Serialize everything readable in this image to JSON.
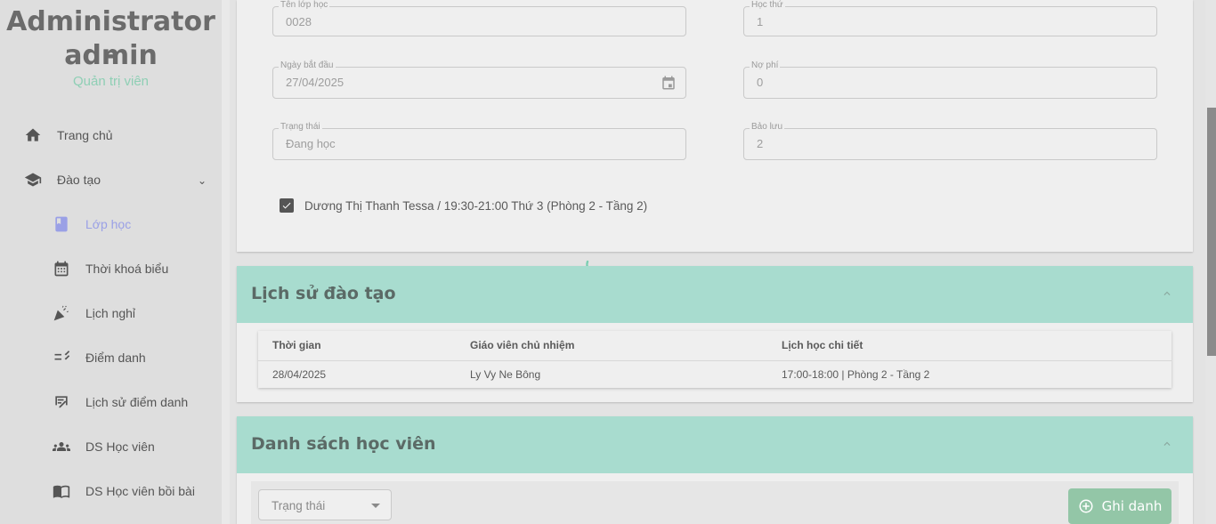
{
  "sidebar": {
    "user_name_line1": "Administrator -",
    "user_name_line2": "admin",
    "user_role": "Quản trị viên",
    "items": [
      {
        "label": "Trang chủ",
        "icon": "home-icon"
      },
      {
        "label": "Đào tạo",
        "icon": "graduation-cap-icon",
        "expanded": true
      },
      {
        "label": "Lớp học",
        "icon": "book-icon",
        "active": true
      },
      {
        "label": "Thời khoá biểu",
        "icon": "calendar-icon"
      },
      {
        "label": "Lịch nghỉ",
        "icon": "party-popper-icon"
      },
      {
        "label": "Điểm danh",
        "icon": "checklist-icon"
      },
      {
        "label": "Lịch sử điểm danh",
        "icon": "history-board-icon"
      },
      {
        "label": "DS Học viên",
        "icon": "group-icon"
      },
      {
        "label": "DS Học viên bồi bài",
        "icon": "open-book-icon"
      }
    ]
  },
  "class_form": {
    "class_name": {
      "label": "Tên lớp học",
      "value": "0028"
    },
    "lesson_no": {
      "label": "Học thứ",
      "value": "1"
    },
    "start_date": {
      "label": "Ngày bắt đầu",
      "value": "27/04/2025"
    },
    "debt": {
      "label": "Nợ phí",
      "value": "0"
    },
    "status": {
      "label": "Trạng thái",
      "value": "Đang học"
    },
    "reserved": {
      "label": "Bảo lưu",
      "value": "2"
    },
    "schedule_checkbox": {
      "label": "Dương Thị Thanh Tessa / 19:30-21:00 Thứ 3 (Phòng 2 - Tầng 2)",
      "checked": true
    }
  },
  "training_history": {
    "title": "Lịch sử đào tạo",
    "columns": [
      "Thời gian",
      "Giáo viên chủ nhiệm",
      "Lịch học chi tiết"
    ],
    "rows": [
      [
        "28/04/2025",
        "Ly Vy Ne Bông",
        "17:00-18:00 | Phòng 2 - Tầng 2"
      ]
    ]
  },
  "student_list": {
    "title": "Danh sách học viên",
    "status_filter_placeholder": "Trạng thái",
    "enroll_button": "Ghi danh"
  },
  "colors": {
    "accent_green": "#a8dccf",
    "active_nav": "#9aa0e6",
    "role_text": "#8fcfb5",
    "button_green": "#93c6a7"
  }
}
